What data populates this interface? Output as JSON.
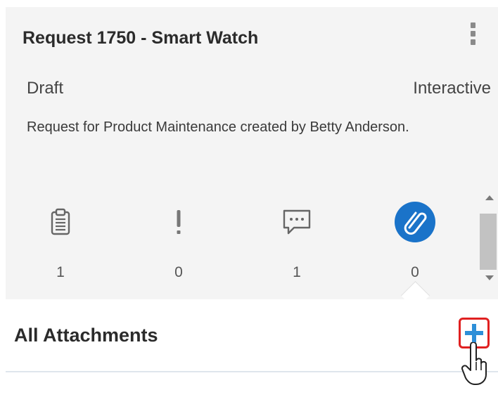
{
  "request": {
    "title": "Request 1750 - Smart Watch",
    "status": "Draft",
    "mode": "Interactive",
    "description": "Request for Product Maintenance created by Betty Anderson."
  },
  "tabs": [
    {
      "icon": "clipboard-icon",
      "count": "1"
    },
    {
      "icon": "exclamation-icon",
      "count": "0"
    },
    {
      "icon": "comment-icon",
      "count": "1"
    },
    {
      "icon": "paperclip-icon",
      "count": "0",
      "active": true
    }
  ],
  "section": {
    "title": "All Attachments"
  },
  "colors": {
    "accent": "#1a73c9",
    "highlight_border": "#e02020",
    "card_bg": "#f4f4f4"
  }
}
